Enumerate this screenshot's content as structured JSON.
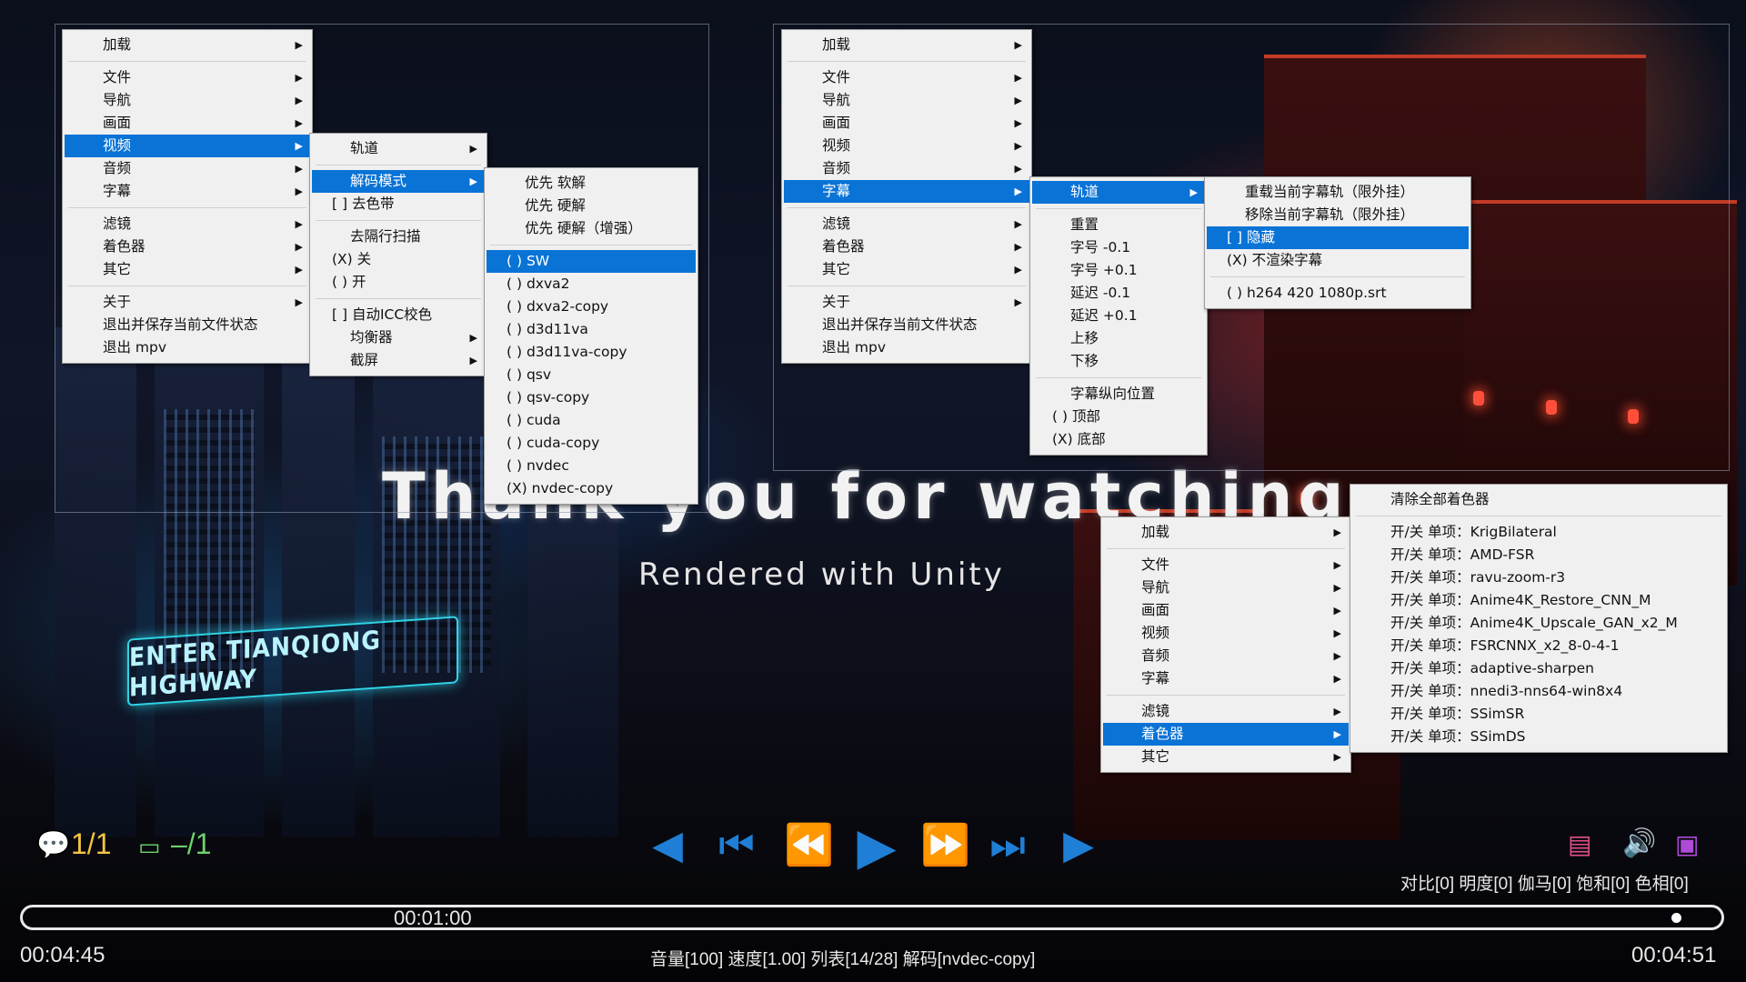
{
  "background": {
    "title": "Thank you for watching",
    "subtitle": "Rendered with Unity",
    "sign": "ENTER TIANQIONG HIGHWAY"
  },
  "menu_left": {
    "main": [
      {
        "label": "加载",
        "sub": true
      },
      {
        "sep": true
      },
      {
        "label": "文件",
        "sub": true
      },
      {
        "label": "导航",
        "sub": true
      },
      {
        "label": "画面",
        "sub": true
      },
      {
        "label": "视频",
        "sub": true,
        "selected": true
      },
      {
        "label": "音频",
        "sub": true
      },
      {
        "label": "字幕",
        "sub": true
      },
      {
        "sep": true
      },
      {
        "label": "滤镜",
        "sub": true
      },
      {
        "label": "着色器",
        "sub": true
      },
      {
        "label": "其它",
        "sub": true
      },
      {
        "sep": true
      },
      {
        "label": "关于",
        "sub": true
      },
      {
        "label": "退出并保存当前文件状态"
      },
      {
        "label": "退出 mpv"
      }
    ],
    "video_sub": [
      {
        "label": "轨道",
        "sub": true
      },
      {
        "sep": true
      },
      {
        "label": "解码模式",
        "sub": true,
        "selected": true
      },
      {
        "label": "[ ] 去色带",
        "check": true
      },
      {
        "sep": true
      },
      {
        "label": "去隔行扫描"
      },
      {
        "label": "(X) 关",
        "check": true
      },
      {
        "label": "( ) 开",
        "check": true
      },
      {
        "sep": true
      },
      {
        "label": "[ ] 自动ICC校色",
        "check": true
      },
      {
        "label": "均衡器",
        "sub": true
      },
      {
        "label": "截屏",
        "sub": true
      }
    ],
    "decode_sub": [
      {
        "label": "优先 软解"
      },
      {
        "label": "优先 硬解"
      },
      {
        "label": "优先 硬解（增强）"
      },
      {
        "sep": true
      },
      {
        "label": "( ) SW",
        "check": true,
        "selected": true
      },
      {
        "label": "( ) dxva2",
        "check": true
      },
      {
        "label": "( ) dxva2-copy",
        "check": true
      },
      {
        "label": "( ) d3d11va",
        "check": true
      },
      {
        "label": "( ) d3d11va-copy",
        "check": true
      },
      {
        "label": "( ) qsv",
        "check": true
      },
      {
        "label": "( ) qsv-copy",
        "check": true
      },
      {
        "label": "( ) cuda",
        "check": true
      },
      {
        "label": "( ) cuda-copy",
        "check": true
      },
      {
        "label": "( ) nvdec",
        "check": true
      },
      {
        "label": "(X) nvdec-copy",
        "check": true
      }
    ]
  },
  "menu_right": {
    "main": [
      {
        "label": "加载",
        "sub": true
      },
      {
        "sep": true
      },
      {
        "label": "文件",
        "sub": true
      },
      {
        "label": "导航",
        "sub": true
      },
      {
        "label": "画面",
        "sub": true
      },
      {
        "label": "视频",
        "sub": true
      },
      {
        "label": "音频",
        "sub": true
      },
      {
        "label": "字幕",
        "sub": true,
        "selected": true
      },
      {
        "sep": true
      },
      {
        "label": "滤镜",
        "sub": true
      },
      {
        "label": "着色器",
        "sub": true
      },
      {
        "label": "其它",
        "sub": true
      },
      {
        "sep": true
      },
      {
        "label": "关于",
        "sub": true
      },
      {
        "label": "退出并保存当前文件状态"
      },
      {
        "label": "退出 mpv"
      }
    ],
    "subtitle_sub": [
      {
        "label": "轨道",
        "sub": true,
        "selected": true
      },
      {
        "sep": true
      },
      {
        "label": "重置"
      },
      {
        "label": "字号 -0.1"
      },
      {
        "label": "字号 +0.1"
      },
      {
        "label": "延迟 -0.1"
      },
      {
        "label": "延迟 +0.1"
      },
      {
        "label": "上移"
      },
      {
        "label": "下移"
      },
      {
        "sep": true
      },
      {
        "label": "字幕纵向位置"
      },
      {
        "label": "( ) 顶部",
        "check": true
      },
      {
        "label": "(X) 底部",
        "check": true
      }
    ],
    "track_sub": [
      {
        "label": "重载当前字幕轨（限外挂）"
      },
      {
        "label": "移除当前字幕轨（限外挂）"
      },
      {
        "label": "[ ] 隐藏",
        "check": true,
        "selected": true
      },
      {
        "label": "(X) 不渲染字幕",
        "check": true
      },
      {
        "sep": true
      },
      {
        "label": "( ) h264 420 1080p.srt",
        "check": true
      }
    ]
  },
  "menu_bottom": {
    "main": [
      {
        "label": "加载",
        "sub": true
      },
      {
        "sep": true
      },
      {
        "label": "文件",
        "sub": true
      },
      {
        "label": "导航",
        "sub": true
      },
      {
        "label": "画面",
        "sub": true
      },
      {
        "label": "视频",
        "sub": true
      },
      {
        "label": "音频",
        "sub": true
      },
      {
        "label": "字幕",
        "sub": true
      },
      {
        "sep": true
      },
      {
        "label": "滤镜",
        "sub": true
      },
      {
        "label": "着色器",
        "sub": true,
        "selected": true
      },
      {
        "label": "其它",
        "sub": true
      }
    ],
    "shader_sub": [
      {
        "label": "清除全部着色器"
      },
      {
        "sep": true
      },
      {
        "label": "开/关 单项：KrigBilateral"
      },
      {
        "label": "开/关 单项：AMD-FSR"
      },
      {
        "label": "开/关 单项：ravu-zoom-r3"
      },
      {
        "label": "开/关 单项：Anime4K_Restore_CNN_M"
      },
      {
        "label": "开/关 单项：Anime4K_Upscale_GAN_x2_M"
      },
      {
        "label": "开/关 单项：FSRCNNX_x2_8-0-4-1"
      },
      {
        "label": "开/关 单项：adaptive-sharpen"
      },
      {
        "label": "开/关 单项：nnedi3-nns64-win8x4"
      },
      {
        "label": "开/关 单项：SSimSR"
      },
      {
        "label": "开/关 单项：SSimDS"
      }
    ]
  },
  "osc": {
    "subtitle_counter": "1/1",
    "audio_counter": "–/1",
    "eq_values": "对比[0]  明度[0]  伽马[0]  饱和[0]  色相[0]",
    "seek_tooltip": "00:01:00",
    "time_elapsed": "00:04:45",
    "time_total": "00:04:51",
    "status_line": "音量[100]   速度[1.00]   列表[14/28]     解码[nvdec-copy]",
    "progress_fraction": 0.979,
    "accent_color": "#1f7fd6"
  }
}
